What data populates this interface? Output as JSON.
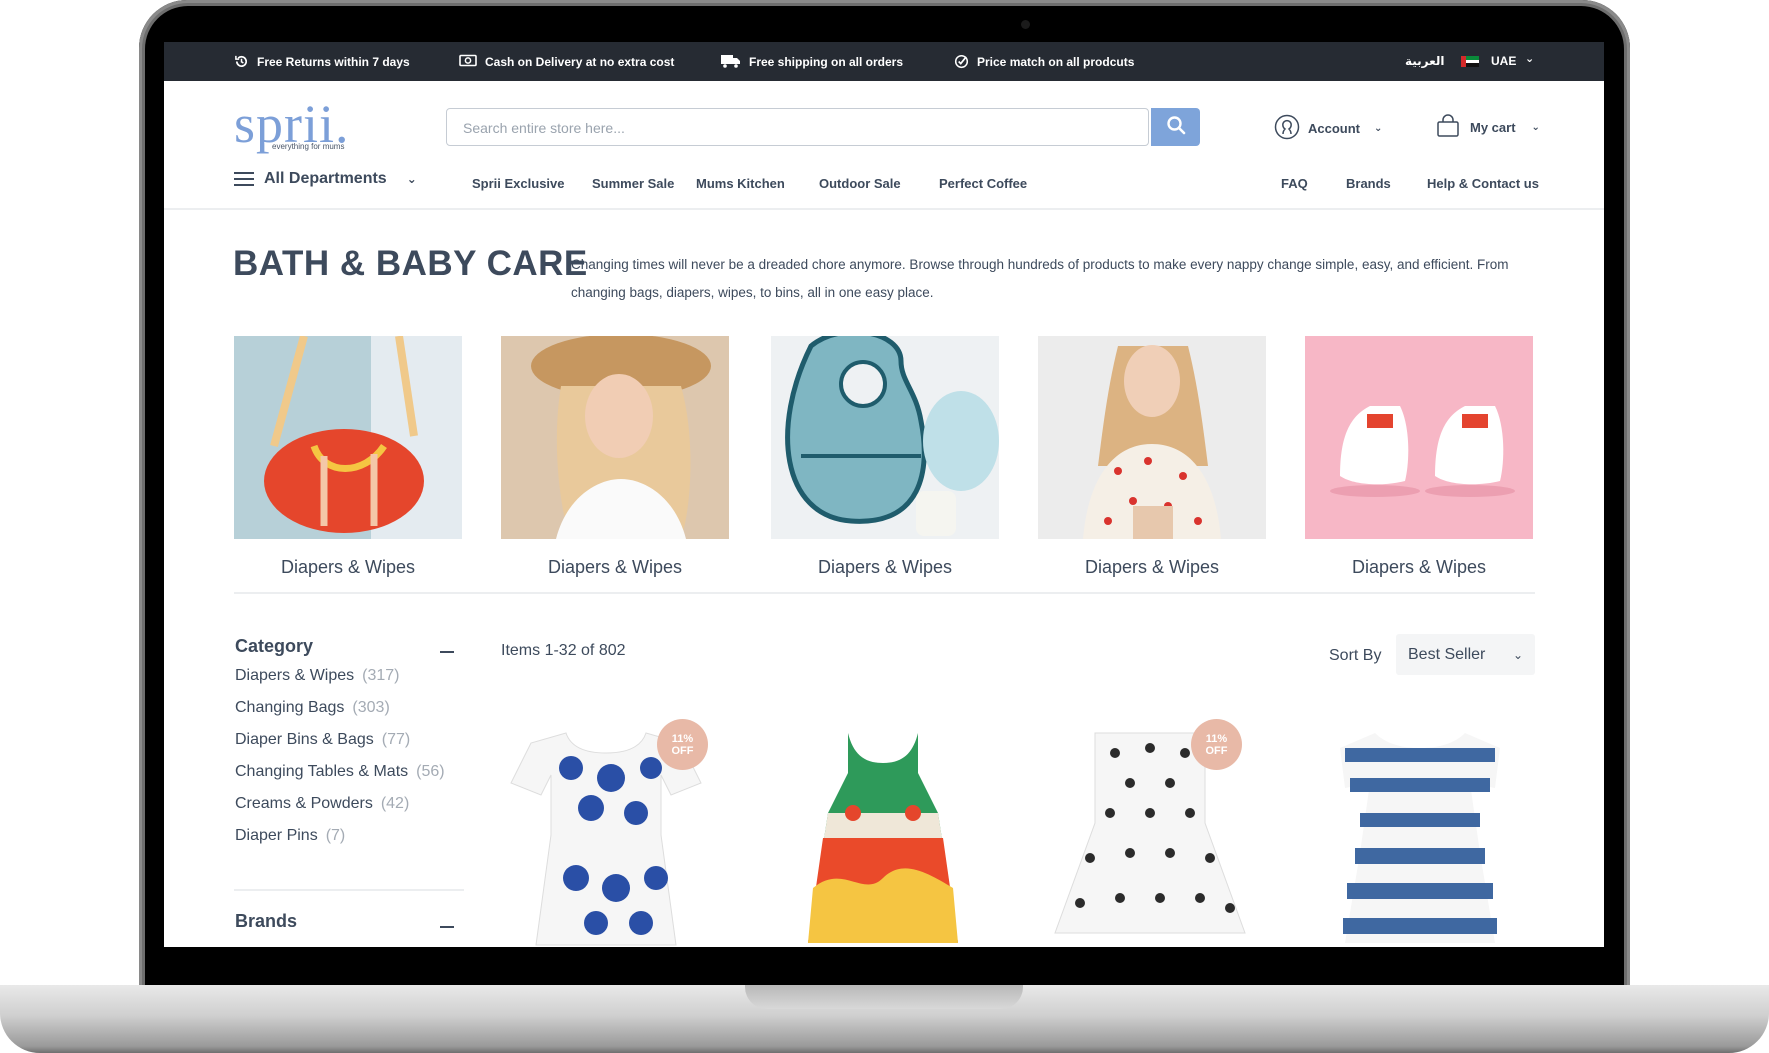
{
  "topbar": {
    "perks": [
      {
        "icon": "history-icon",
        "label": "Free Returns within 7 days"
      },
      {
        "icon": "cash-icon",
        "label": "Cash on Delivery at no extra cost"
      },
      {
        "icon": "truck-icon",
        "label": "Free shipping on all orders"
      },
      {
        "icon": "check-badge-icon",
        "label": "Price match on all prodcuts"
      }
    ],
    "language": "العربية",
    "country": "UAE"
  },
  "header": {
    "logo_word": "sprii.",
    "logo_tagline": "everything for mums",
    "search_placeholder": "Search entire store here...",
    "search_value": "",
    "account_label": "Account",
    "cart_label": "My cart"
  },
  "nav": {
    "all_departments": "All Departments",
    "links": [
      "Sprii Exclusive",
      "Summer Sale",
      "Mums Kitchen",
      "Outdoor Sale",
      "Perfect Coffee"
    ],
    "right_links": [
      "FAQ",
      "Brands",
      "Help & Contact us"
    ]
  },
  "hero": {
    "title": "BATH & BABY CARE",
    "description": "Changing times will never be a dreaded chore anymore. Browse through hundreds of products to make every nappy change simple, easy, and efficient. From changing bags, diapers, wipes, to bins, all in one easy place."
  },
  "categories": [
    {
      "label": "Diapers & Wipes",
      "image": "red-bag"
    },
    {
      "label": "Diapers & Wipes",
      "image": "girl-straw-hat"
    },
    {
      "label": "Diapers & Wipes",
      "image": "blue-bib"
    },
    {
      "label": "Diapers & Wipes",
      "image": "girl-cherry-top"
    },
    {
      "label": "Diapers & Wipes",
      "image": "white-baby-shoes"
    }
  ],
  "sidebar": {
    "category_title": "Category",
    "category_items": [
      {
        "label": "Diapers & Wipes",
        "count": "(317)"
      },
      {
        "label": "Changing Bags",
        "count": "(303)"
      },
      {
        "label": "Diaper Bins & Bags",
        "count": "(77)"
      },
      {
        "label": "Changing Tables & Mats",
        "count": "(56)"
      },
      {
        "label": "Creams & Powders",
        "count": "(42)"
      },
      {
        "label": "Diaper Pins",
        "count": "(7)"
      }
    ],
    "brands_title": "Brands"
  },
  "toolbar": {
    "items_count": "Items 1-32 of 802",
    "sort_label": "Sort By",
    "sort_value": "Best Seller"
  },
  "products": [
    {
      "image": "blue-floral-dress",
      "badge_pct": "11%",
      "badge_off": "OFF"
    },
    {
      "image": "green-red-yellow-dress",
      "badge_pct": null,
      "badge_off": null
    },
    {
      "image": "polka-dot-dress",
      "badge_pct": "11%",
      "badge_off": "OFF"
    },
    {
      "image": "blue-striped-dress",
      "badge_pct": null,
      "badge_off": null
    }
  ],
  "colors": {
    "topbar_bg": "#262b33",
    "brand_blue": "#7ea4da",
    "text": "#3d4a5c",
    "muted": "#a4abb4",
    "badge": "#e8b9a7"
  }
}
